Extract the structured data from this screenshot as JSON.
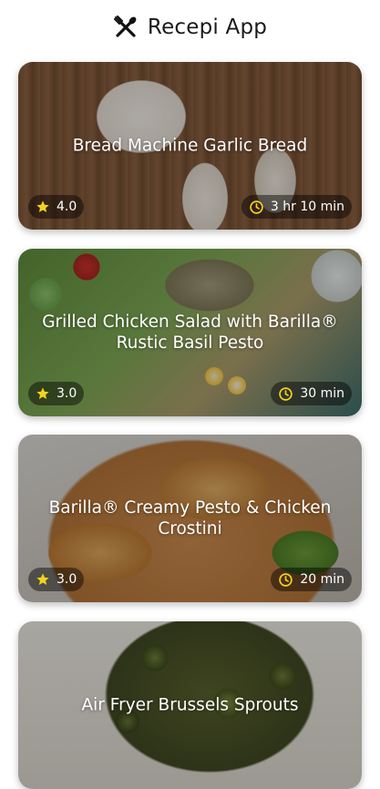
{
  "app": {
    "title": "Recepi App",
    "logo_icon": "fork-knife-icon"
  },
  "colors": {
    "accent_star": "#f5d21c",
    "accent_clock": "#f5d21c",
    "chip_bg": "rgba(0,0,0,0.45)"
  },
  "recipes": [
    {
      "title": "Bread Machine Garlic Bread",
      "rating": "4.0",
      "time": "3 hr 10 min"
    },
    {
      "title": "Grilled Chicken Salad with Barilla® Rustic Basil Pesto",
      "rating": "3.0",
      "time": "30 min"
    },
    {
      "title": "Barilla® Creamy Pesto & Chicken Crostini",
      "rating": "3.0",
      "time": "20 min"
    },
    {
      "title": "Air Fryer Brussels Sprouts",
      "rating": "",
      "time": ""
    }
  ]
}
